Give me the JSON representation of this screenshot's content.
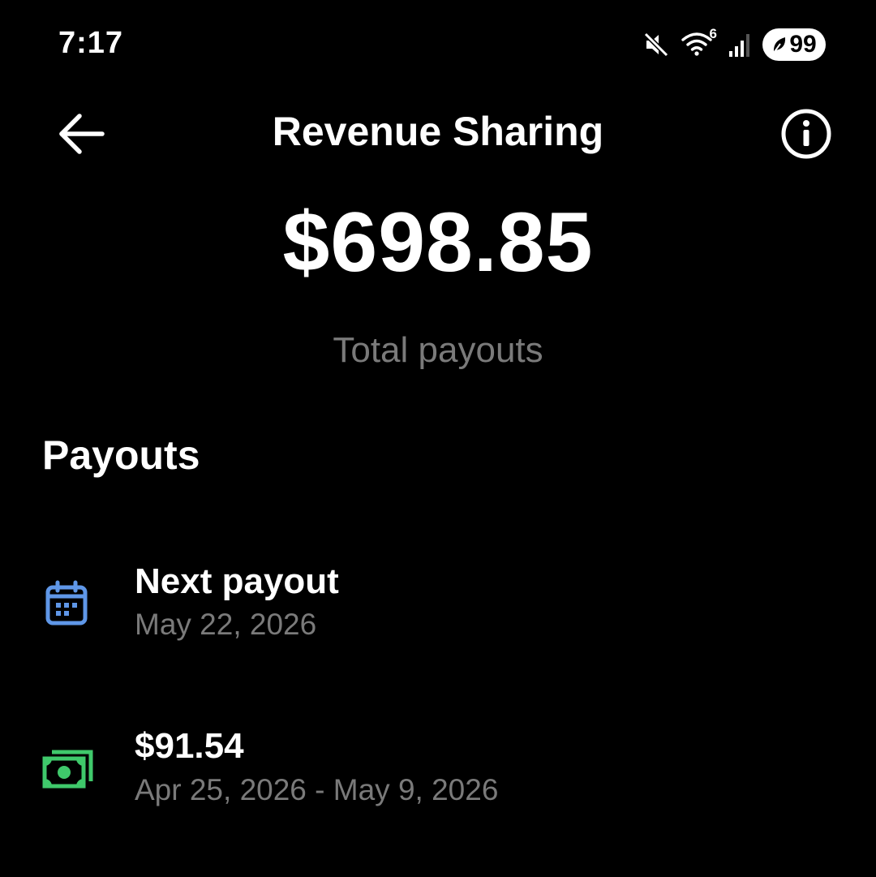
{
  "status_bar": {
    "time": "7:17",
    "icons": [
      "mute-icon",
      "wifi-icon",
      "signal-icon",
      "battery-icon"
    ],
    "wifi_label": "6",
    "battery_level": "99"
  },
  "header": {
    "title": "Revenue Sharing",
    "back_icon": "arrow-left-icon",
    "info_icon": "info-icon"
  },
  "summary": {
    "total_amount": "$698.85",
    "total_label": "Total payouts"
  },
  "payouts": {
    "section_title": "Payouts",
    "items": [
      {
        "icon": "calendar-icon",
        "icon_color": "#5f97e8",
        "title": "Next payout",
        "subtitle": "May 22, 2026"
      },
      {
        "icon": "money-icon",
        "icon_color": "#3fc96b",
        "title": "$91.54",
        "subtitle": "Apr 25, 2026 - May 9, 2026"
      }
    ]
  },
  "colors": {
    "background": "#000000",
    "text_primary": "#ffffff",
    "text_secondary": "#7a7a7a"
  }
}
